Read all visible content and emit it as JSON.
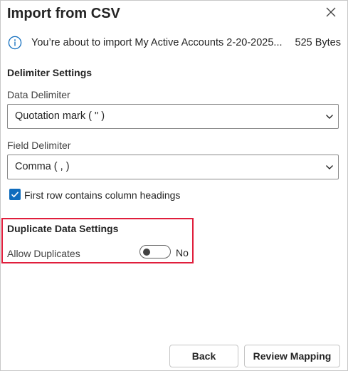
{
  "dialog": {
    "title": "Import from CSV",
    "close_icon": "close-icon"
  },
  "info": {
    "icon": "info-icon",
    "message": "You’re about to import My Active Accounts 2-20-2025...",
    "file_size": "525 Bytes",
    "accent_color": "#0f6cbd"
  },
  "delimiter_settings": {
    "heading": "Delimiter Settings",
    "data_delimiter": {
      "label": "Data Delimiter",
      "value": "Quotation mark ( \" )"
    },
    "field_delimiter": {
      "label": "Field Delimiter",
      "value": "Comma ( , )"
    },
    "first_row_headings": {
      "label": "First row contains column headings",
      "checked": true
    }
  },
  "duplicate_settings": {
    "heading": "Duplicate Data Settings",
    "allow_duplicates": {
      "label": "Allow Duplicates",
      "state_text": "No",
      "on": false
    },
    "highlight_color": "#e01e3c"
  },
  "footer": {
    "back_label": "Back",
    "review_label": "Review Mapping"
  }
}
